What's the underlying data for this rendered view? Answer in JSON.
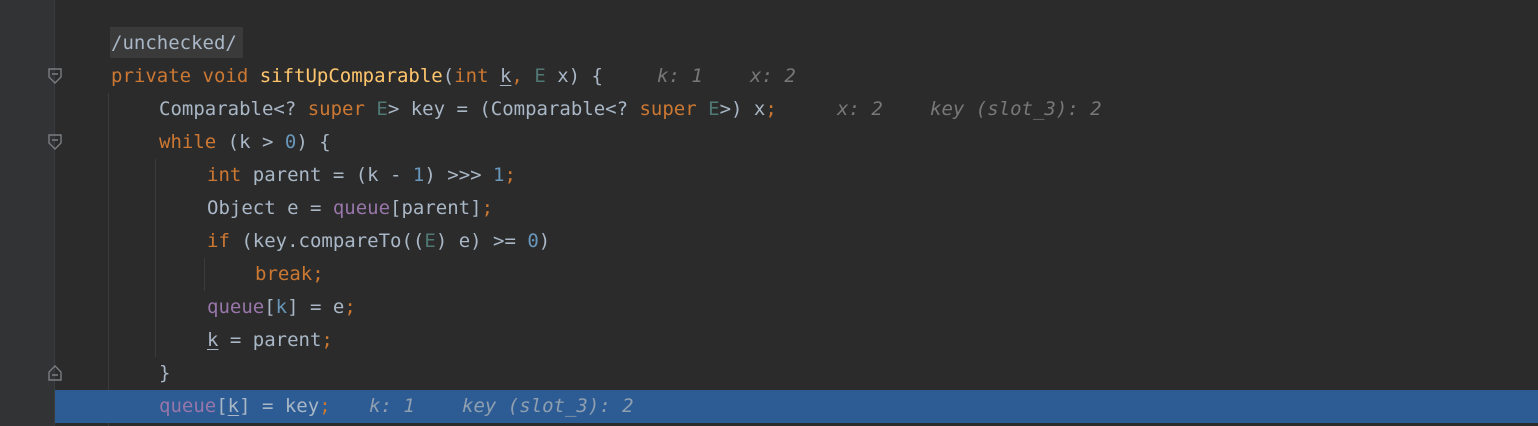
{
  "editor": {
    "language": "Java",
    "colors": {
      "background": "#2b2b2b",
      "gutter": "#313335",
      "current_line": "#2d5c94",
      "keyword": "#cc7832",
      "function": "#ffc66d",
      "number": "#6897bb",
      "field": "#9876aa",
      "type_param": "#507874",
      "plain": "#a9b7c6",
      "inlay_hint": "#787878"
    },
    "gutter_icons": [
      "fold-start-icon",
      "fold-start-icon",
      "fold-end-icon"
    ],
    "lines": [
      {
        "tokens": [
          {
            "t": "/unchecked/",
            "c": "plain"
          }
        ],
        "hints": []
      },
      {
        "tokens": [
          {
            "t": "private ",
            "c": "kw"
          },
          {
            "t": "void ",
            "c": "kw"
          },
          {
            "t": "siftUpComparable",
            "c": "fn"
          },
          {
            "t": "(",
            "c": "plain"
          },
          {
            "t": "int ",
            "c": "kw"
          },
          {
            "t": "k",
            "c": "plain",
            "u": true
          },
          {
            "t": ", ",
            "c": "kw"
          },
          {
            "t": "E ",
            "c": "tp"
          },
          {
            "t": "x) {",
            "c": "plain"
          }
        ],
        "hints": [
          "k: 1",
          "x: 2"
        ]
      },
      {
        "tokens": [
          {
            "t": "Comparable<? ",
            "c": "plain"
          },
          {
            "t": "super ",
            "c": "kw"
          },
          {
            "t": "E",
            "c": "tp"
          },
          {
            "t": "> key = (Comparable<? ",
            "c": "plain"
          },
          {
            "t": "super ",
            "c": "kw"
          },
          {
            "t": "E",
            "c": "tp"
          },
          {
            "t": ">) x",
            "c": "plain"
          },
          {
            "t": ";",
            "c": "kw"
          }
        ],
        "hints": [
          "x: 2",
          "key (slot_3): 2"
        ]
      },
      {
        "tokens": [
          {
            "t": "while ",
            "c": "kw"
          },
          {
            "t": "(",
            "c": "plain"
          },
          {
            "t": "k",
            "c": "plain"
          },
          {
            "t": " > ",
            "c": "plain"
          },
          {
            "t": "0",
            "c": "num"
          },
          {
            "t": ") {",
            "c": "plain"
          }
        ],
        "hints": []
      },
      {
        "tokens": [
          {
            "t": "int ",
            "c": "kw"
          },
          {
            "t": "parent = (k - ",
            "c": "plain"
          },
          {
            "t": "1",
            "c": "num"
          },
          {
            "t": ") >>> ",
            "c": "plain"
          },
          {
            "t": "1",
            "c": "num"
          },
          {
            "t": ";",
            "c": "kw"
          }
        ],
        "hints": []
      },
      {
        "tokens": [
          {
            "t": "Object e = ",
            "c": "plain"
          },
          {
            "t": "queue",
            "c": "fld"
          },
          {
            "t": "[parent]",
            "c": "plain"
          },
          {
            "t": ";",
            "c": "kw"
          }
        ],
        "hints": []
      },
      {
        "tokens": [
          {
            "t": "if ",
            "c": "kw"
          },
          {
            "t": "(key.compareTo((",
            "c": "plain"
          },
          {
            "t": "E",
            "c": "tp"
          },
          {
            "t": ") e) >= ",
            "c": "plain"
          },
          {
            "t": "0",
            "c": "num"
          },
          {
            "t": ")",
            "c": "plain"
          }
        ],
        "hints": []
      },
      {
        "tokens": [
          {
            "t": "break",
            "c": "kw"
          },
          {
            "t": ";",
            "c": "kw"
          }
        ],
        "hints": []
      },
      {
        "tokens": [
          {
            "t": "queue",
            "c": "fld"
          },
          {
            "t": "[",
            "c": "plain"
          },
          {
            "t": "k",
            "c": "num"
          },
          {
            "t": "] = e",
            "c": "plain"
          },
          {
            "t": ";",
            "c": "kw"
          }
        ],
        "hints": []
      },
      {
        "tokens": [
          {
            "t": "k",
            "c": "plain",
            "u": true
          },
          {
            "t": " = parent",
            "c": "plain"
          },
          {
            "t": ";",
            "c": "kw"
          }
        ],
        "hints": []
      },
      {
        "tokens": [
          {
            "t": "}",
            "c": "plain"
          }
        ],
        "hints": []
      },
      {
        "tokens": [
          {
            "t": "queue",
            "c": "fld"
          },
          {
            "t": "[",
            "c": "plain"
          },
          {
            "t": "k",
            "c": "plain",
            "u": true
          },
          {
            "t": "] = key",
            "c": "plain"
          },
          {
            "t": ";",
            "c": "kw"
          }
        ],
        "hints": [
          "k: 1",
          "key (slot_3): 2"
        ],
        "current": true
      }
    ]
  }
}
